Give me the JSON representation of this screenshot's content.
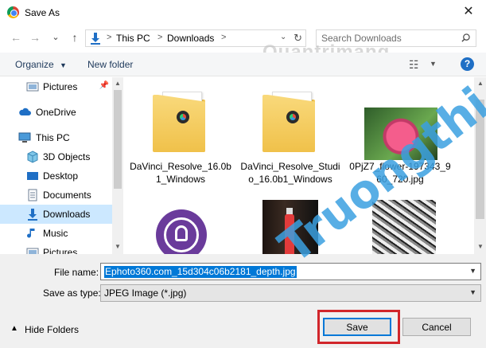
{
  "window": {
    "title": "Save As",
    "close_glyph": "✕"
  },
  "navigation": {
    "back_glyph": "←",
    "forward_glyph": "→",
    "recent_glyph": "⌄",
    "up_glyph": "↑",
    "address": {
      "items": [
        "This PC",
        "Downloads"
      ],
      "separator": ">",
      "refresh_glyph": "↻"
    },
    "search": {
      "placeholder": "Search Downloads"
    }
  },
  "toolbar": {
    "organize_label": "Organize",
    "new_folder_label": "New folder",
    "help_glyph": "?",
    "view_glyph": "☷"
  },
  "sidebar": {
    "items": [
      {
        "label": "Pictures",
        "icon": "pictures-icon",
        "pinned": true
      },
      {
        "label": "OneDrive",
        "icon": "cloud-icon"
      },
      {
        "label": "This PC",
        "icon": "computer-icon"
      },
      {
        "label": "3D Objects",
        "icon": "cube-icon"
      },
      {
        "label": "Desktop",
        "icon": "desktop-icon"
      },
      {
        "label": "Documents",
        "icon": "documents-icon"
      },
      {
        "label": "Downloads",
        "icon": "download-icon",
        "selected": true
      },
      {
        "label": "Music",
        "icon": "music-icon"
      },
      {
        "label": "Pictures",
        "icon": "pictures-icon"
      }
    ]
  },
  "files": [
    {
      "name": "DaVinci_Resolve_16.0b1_Windows",
      "type": "folder"
    },
    {
      "name": "DaVinci_Resolve_Studio_16.0b1_Windows",
      "type": "folder"
    },
    {
      "name": "0PjZ7_flower-197343_960_720.jpg",
      "type": "image"
    },
    {
      "name": "",
      "type": "image"
    },
    {
      "name": "",
      "type": "image"
    },
    {
      "name": "",
      "type": "image"
    }
  ],
  "form": {
    "filename_label": "File name:",
    "filename_value": "Ephoto360.com_15d304c06b2181_depth.jpg",
    "savetype_label": "Save as type:",
    "savetype_value": "JPEG Image (*.jpg)",
    "hide_folders_label": "Hide Folders",
    "save_label": "Save",
    "cancel_label": "Cancel"
  },
  "watermarks": {
    "top": "Quantrimang",
    "diagonal": "Truongthi.top"
  },
  "colors": {
    "selection": "#cce8ff",
    "accent": "#0078d7",
    "highlight": "#d1262b"
  }
}
